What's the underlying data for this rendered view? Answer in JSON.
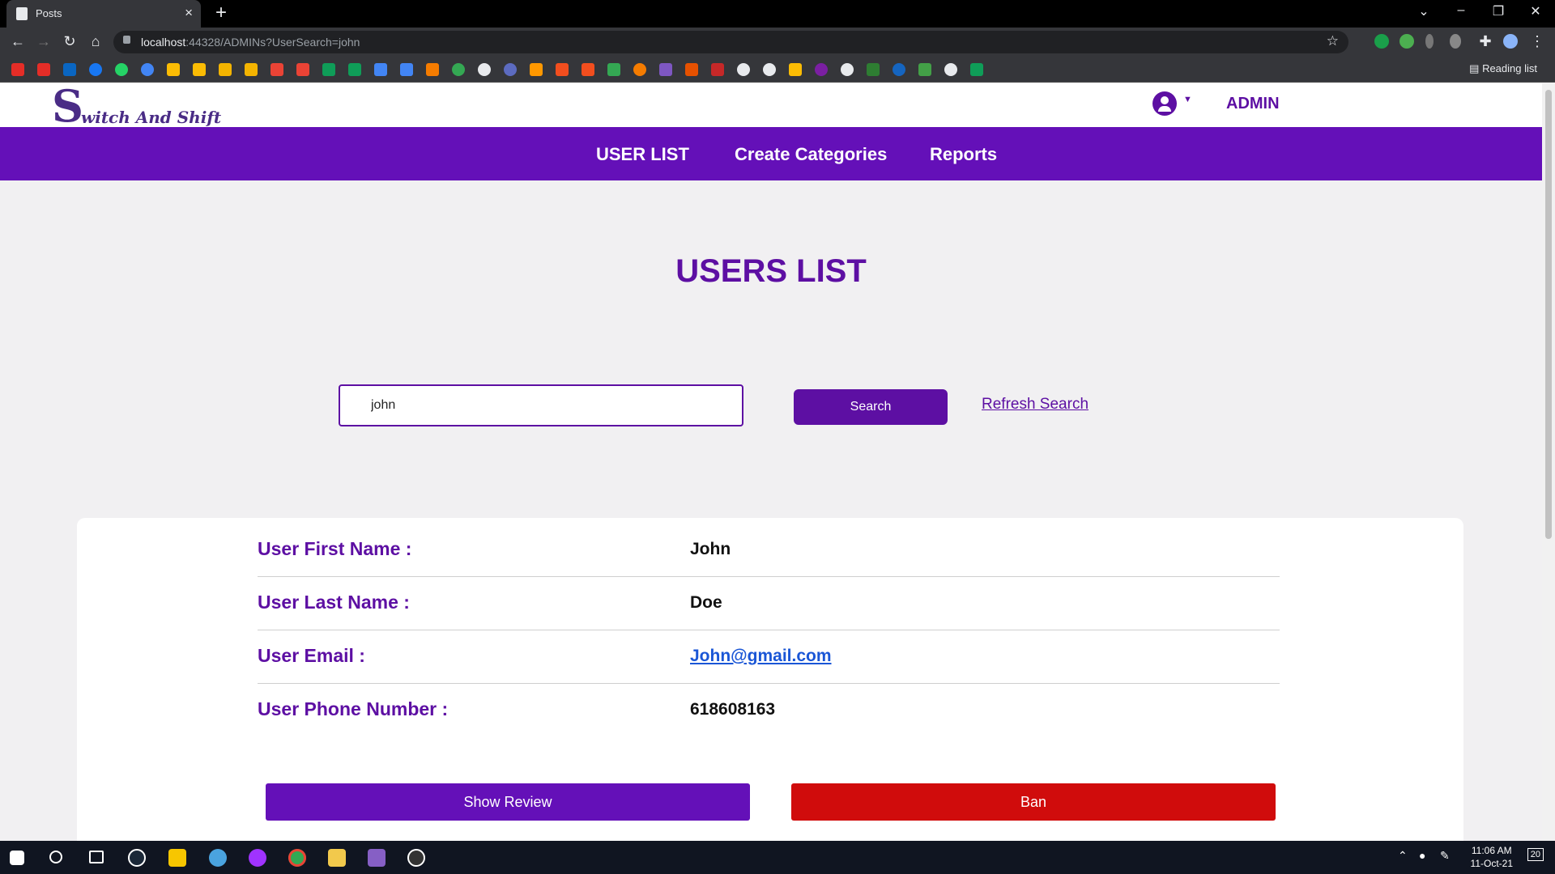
{
  "browser": {
    "tab_title": "Posts",
    "url_host": "localhost",
    "url_rest": ":44328/ADMINs?UserSearch=john",
    "reading_list": "Reading list"
  },
  "site": {
    "logo_initial": "S",
    "logo_rest": "witch And Shift",
    "admin_label": "ADMIN",
    "nav": [
      "USER LIST",
      "Create Categories",
      "Reports"
    ],
    "accent_color": "#6410b8",
    "ban_color": "#d00c0c"
  },
  "main": {
    "title": "USERS LIST",
    "search_value": "john",
    "search_button": "Search",
    "refresh_link": "Refresh Search"
  },
  "user": {
    "rows": [
      {
        "label": "User First Name :",
        "value": "John"
      },
      {
        "label": "User Last Name :",
        "value": "Doe"
      },
      {
        "label": "User Email :",
        "value": "John@gmail.com"
      },
      {
        "label": "User Phone Number :",
        "value": "618608163"
      }
    ],
    "show_review": "Show Review",
    "ban": "Ban"
  },
  "taskbar": {
    "time": "11:06 AM",
    "date": "11-Oct-21",
    "notifications": "20"
  }
}
